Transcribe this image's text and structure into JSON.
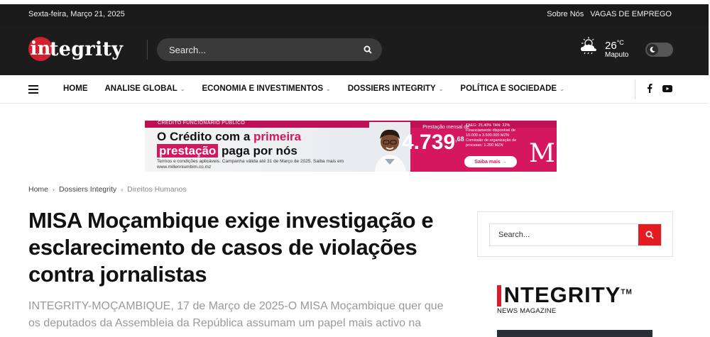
{
  "topbar": {
    "date": "Sexta-feira, Março 21, 2025",
    "links": [
      "Sobre Nós",
      "VAGAS DE EMPREGO"
    ]
  },
  "header": {
    "logo_letter": "in",
    "logo_text": "tegrity",
    "search_placeholder": "Search...",
    "weather": {
      "temp": "26",
      "unit": "°C",
      "city": "Maputo"
    }
  },
  "nav": {
    "items": [
      {
        "label": "HOME",
        "has_dropdown": false
      },
      {
        "label": "ANALISE GLOBAL",
        "has_dropdown": true
      },
      {
        "label": "ECONOMIA E INVESTIMENTOS",
        "has_dropdown": true
      },
      {
        "label": "DOSSIERS INTEGRITY",
        "has_dropdown": true
      },
      {
        "label": "POLÍTICA E SOCIEDADE",
        "has_dropdown": true
      }
    ]
  },
  "banner": {
    "tag": "CRÉDITO FUNCIONÁRIO PÚBLICO",
    "line1_a": "O Crédito com a ",
    "line1_b": "primeira",
    "line2_a": "prestação",
    "line2_b": " paga por nós",
    "small": "Termos e condições aplicáveis. Campanha válida até 31 de Março de 2025. Saiba mais em www.millenniumbim.co.mz",
    "offer": "Prestação mensal de",
    "amount": "4.739",
    "amount_cents": ",68",
    "amount_currency": "MZN",
    "amount_note": "para 300.000 MZN em 84 meses",
    "terms": "TAEG: 25,40%   TAN: 22%  Financiamento disponível de 10.000 a 3.500.000 MZN  Comissão de organização de processo: 1.200 MZN",
    "cta": "Saiba mais →",
    "brand_letter": "M"
  },
  "breadcrumb": [
    "Home",
    "Dossiers Integrity",
    "Direitos Humanos"
  ],
  "article": {
    "title": "MISA Moçambique exige investigação e esclarecimento de casos de violações contra jornalistas",
    "lead": "INTEGRITY-MOÇAMBIQUE, 17 de Março de 2025-O MISA Moçambique quer que os deputados da Assembleia da República assumam um papel mais activo na"
  },
  "sidebar": {
    "search_placeholder": "Search...",
    "brand_name": "NTEGRITY",
    "brand_tm": "TM",
    "brand_sub": "NEWS MAGAZINE"
  },
  "colors": {
    "accent": "#e31b23",
    "banner": "#d5175f",
    "header": "#1c1c1c"
  }
}
